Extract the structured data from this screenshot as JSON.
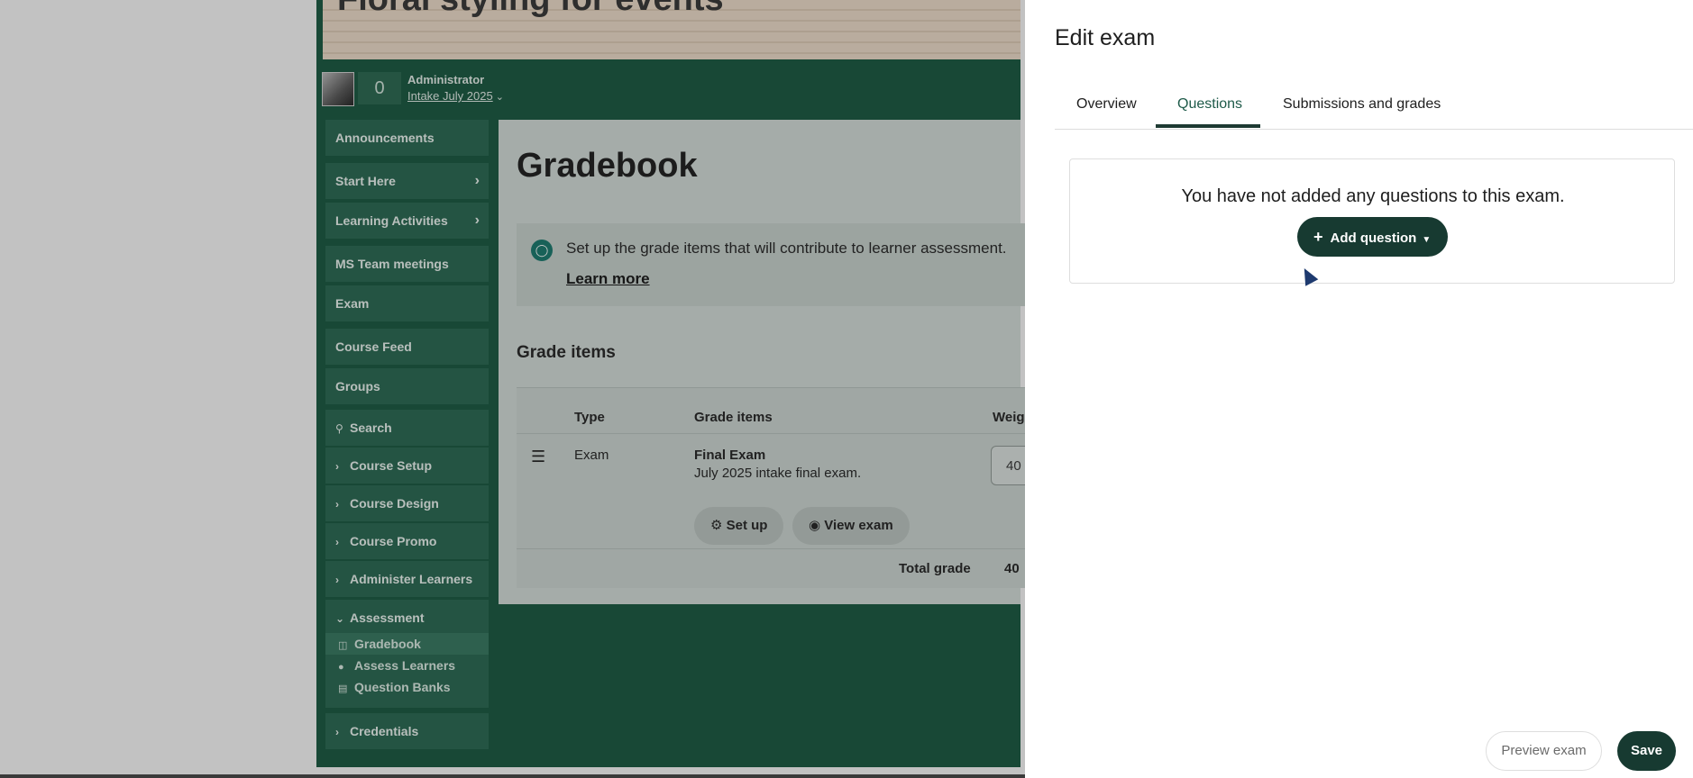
{
  "course": {
    "banner_title": "Floral styling for events",
    "user_role": "Administrator",
    "user_intake": "Intake July 2025",
    "notification_count": "0"
  },
  "sidebar": {
    "items": [
      {
        "label": "Announcements"
      },
      {
        "label": "Start Here"
      },
      {
        "label": "Learning Activities"
      },
      {
        "label": "MS Team meetings"
      },
      {
        "label": "Exam"
      },
      {
        "label": "Course Feed"
      },
      {
        "label": "Groups"
      },
      {
        "label": "Search"
      },
      {
        "label": "Course Setup"
      },
      {
        "label": "Course Design"
      },
      {
        "label": "Course Promo"
      },
      {
        "label": "Administer Learners"
      },
      {
        "label": "Assessment"
      }
    ],
    "sub_items": [
      {
        "label": "Gradebook"
      },
      {
        "label": "Assess Learners"
      },
      {
        "label": "Question Banks"
      }
    ],
    "credentials": "Credentials"
  },
  "gradebook": {
    "title": "Gradebook",
    "info_text": "Set up the grade items that will contribute to learner assessment.",
    "learn_more": "Learn more",
    "grade_items_title": "Grade items",
    "columns": {
      "type": "Type",
      "grade_items": "Grade items",
      "weight": "Weigh"
    },
    "row": {
      "type": "Exam",
      "name": "Final Exam",
      "description": "July 2025 intake final exam.",
      "setup_label": "Set up",
      "view_label": "View exam",
      "weight": "40"
    },
    "total_label": "Total grade",
    "total_value": "40"
  },
  "panel": {
    "title": "Edit exam",
    "tabs": [
      "Overview",
      "Questions",
      "Submissions and grades"
    ],
    "active_tab": "Questions",
    "empty_message": "You have not added any questions to this exam.",
    "add_question_label": "Add question",
    "preview_label": "Preview exam",
    "save_label": "Save"
  },
  "colors": {
    "accent_dark": "#173a31",
    "course_green": "#1f5a44",
    "overlay": "rgba(0,0,0,0.20)"
  },
  "icons": {
    "info": "lightbulb-icon",
    "plus": "plus-icon",
    "caret": "caret-down-icon",
    "gear": "gear-icon",
    "eye": "eye-icon",
    "drag": "drag-handle-icon"
  }
}
